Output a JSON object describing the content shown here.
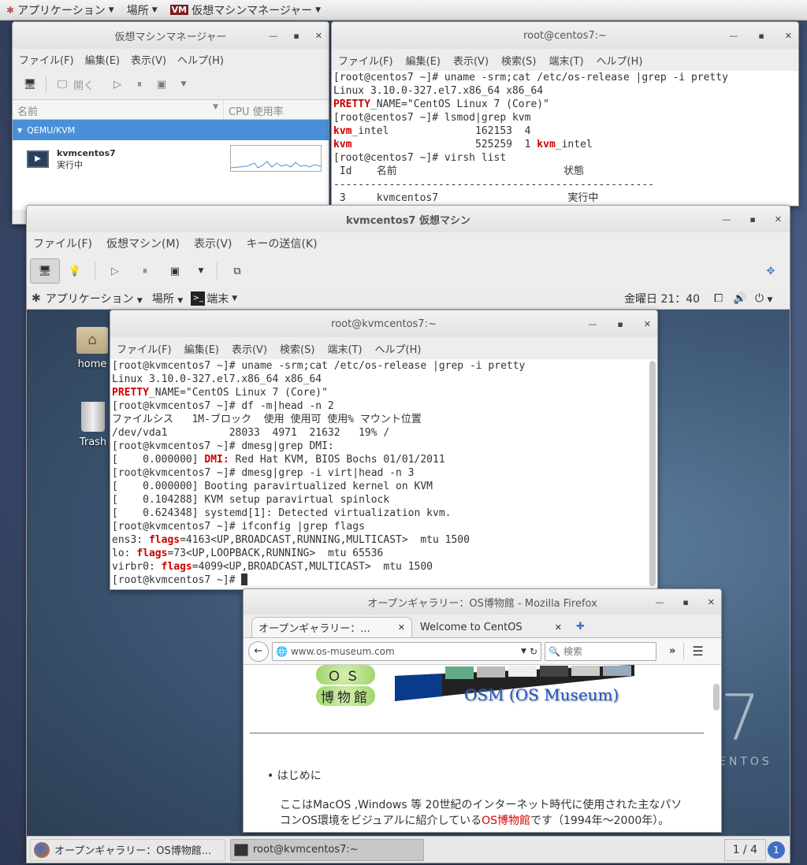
{
  "host_topbar": {
    "apps": "アプリケーション",
    "places": "場所",
    "vmm": "仮想マシンマネージャー"
  },
  "vmm": {
    "title": "仮想マシンマネージャー",
    "menu": [
      "ファイル(F)",
      "編集(E)",
      "表示(V)",
      "ヘルプ(H)"
    ],
    "open_label": "開く",
    "col_name": "名前",
    "col_cpu": "CPU 使用率",
    "group": "QEMU/KVM",
    "vm_name": "kvmcentos7",
    "vm_state": "実行中"
  },
  "host_term": {
    "title": "root@centos7:~",
    "menu": [
      "ファイル(F)",
      "編集(E)",
      "表示(V)",
      "検索(S)",
      "端末(T)",
      "ヘルプ(H)"
    ],
    "l1": "[root@centos7 ~]# uname -srm;cat /etc/os-release |grep -i pretty",
    "l2": "Linux 3.10.0-327.el7.x86_64 x86_64",
    "l3a": "PRETTY",
    "l3b": "_NAME=\"CentOS Linux 7 (Core)\"",
    "l4": "[root@centos7 ~]# lsmod|grep kvm",
    "l5a": "kvm",
    "l5b": "_intel              162153  4",
    "l6a": "kvm",
    "l6b": "                    525259  1 ",
    "l6c": "kvm",
    "l6d": "_intel",
    "l7": "[root@centos7 ~]# virsh list",
    "l8": " Id    名前                           状態",
    "l9": "----------------------------------------------------",
    "l10": " 3     kvmcentos7                     実行中"
  },
  "vmwin": {
    "title": "kvmcentos7 仮想マシン",
    "menu": [
      "ファイル(F)",
      "仮想マシン(M)",
      "表示(V)",
      "キーの送信(K)"
    ]
  },
  "guest_topbar": {
    "apps": "アプリケーション",
    "places": "場所",
    "terminal": "端末",
    "clock": "金曜日 21：40"
  },
  "desktop": {
    "home": "home",
    "trash": "Trash",
    "centos_big": "7",
    "centos_word": "ENTOS"
  },
  "guest_term": {
    "title": "root@kvmcentos7:~",
    "menu": [
      "ファイル(F)",
      "編集(E)",
      "表示(V)",
      "検索(S)",
      "端末(T)",
      "ヘルプ(H)"
    ],
    "g1": "[root@kvmcentos7 ~]# uname -srm;cat /etc/os-release |grep -i pretty",
    "g2": "Linux 3.10.0-327.el7.x86_64 x86_64",
    "g3a": "PRETTY",
    "g3b": "_NAME=\"CentOS Linux 7 (Core)\"",
    "g4": "[root@kvmcentos7 ~]# df -m|head -n 2",
    "g5": "ファイルシス   1M-ブロック  使用 使用可 使用% マウント位置",
    "g6": "/dev/vda1          28033  4971  21632   19% /",
    "g7": "[root@kvmcentos7 ~]# dmesg|grep DMI:",
    "g8a": "[    0.000000] ",
    "g8b": "DMI:",
    "g8c": " Red Hat KVM, BIOS Bochs 01/01/2011",
    "g9": "[root@kvmcentos7 ~]# dmesg|grep -i virt|head -n 3",
    "g10": "[    0.000000] Booting paravirtualized kernel on KVM",
    "g11": "[    0.104288] KVM setup paravirtual spinlock",
    "g12": "[    0.624348] systemd[1]: Detected virtualization kvm.",
    "g13": "[root@kvmcentos7 ~]# ifconfig |grep flags",
    "g14a": "ens3: ",
    "g14b": "flags",
    "g14c": "=4163<UP,BROADCAST,RUNNING,MULTICAST>  mtu 1500",
    "g15a": "lo: ",
    "g15b": "flags",
    "g15c": "=73<UP,LOOPBACK,RUNNING>  mtu 65536",
    "g16a": "virbr0: ",
    "g16b": "flags",
    "g16c": "=4099<UP,BROADCAST,MULTICAST>  mtu 1500",
    "g17": "[root@kvmcentos7 ~]# "
  },
  "firefox": {
    "title": "オープンギャラリー：OS博物館  -  Mozilla Firefox",
    "tab1": "オープンギャラリー：...",
    "tab2": "Welcome to CentOS",
    "url": "www.os-museum.com",
    "search_placeholder": "検索",
    "logo_os": "ＯＳ",
    "logo_hakubutsukan": "博物館",
    "osm": "OSM (OS Museum)",
    "bullet": "はじめに",
    "p1": "ここはMacOS ,Windows 等 20世紀のインターネット時代に使用された主なパソ",
    "p2a": "コンOS環境をビジュアルに紹介している",
    "p2b": "OS博物館",
    "p2c": "です（1994年〜2000年）。"
  },
  "taskbar": {
    "item1": "オープンギャラリー：OS博物館...",
    "item2": "root@kvmcentos7:~",
    "pager": "1 / 4"
  }
}
